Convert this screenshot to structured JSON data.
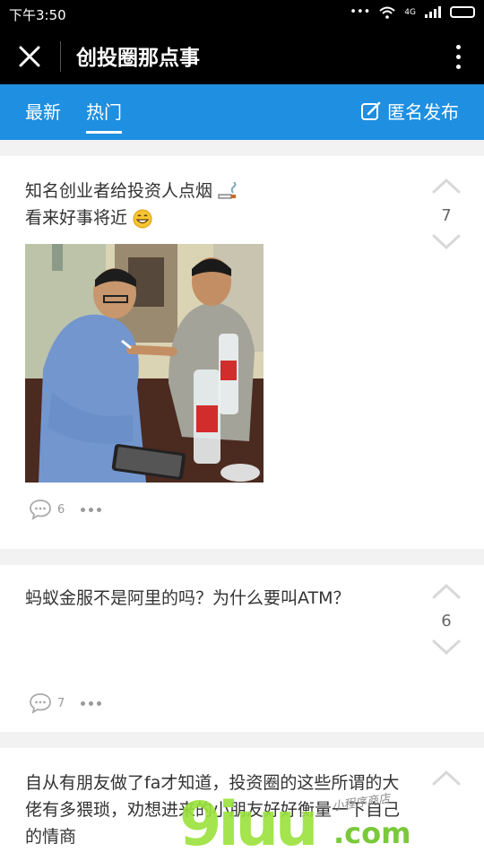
{
  "status_bar": {
    "time": "下午3:50",
    "network": "4G"
  },
  "header": {
    "title": "创投圈那点事"
  },
  "tabs": [
    {
      "label": "最新",
      "active": false
    },
    {
      "label": "热门",
      "active": true
    }
  ],
  "anonymous_post_label": "匿名发布",
  "colors": {
    "accent": "#1e8fe1",
    "header_bg": "#000000",
    "watermark_green": "#9be23b"
  },
  "posts": [
    {
      "text_line1": "知名创业者给投资人点烟",
      "text_line2": "看来好事将近",
      "votes": "7",
      "comments": "6",
      "has_image": true
    },
    {
      "text": "蚂蚁金服不是阿里的吗？为什么要叫ATM？",
      "votes": "6",
      "comments": "7",
      "has_image": false
    },
    {
      "text": "自从有朋友做了fa才知道，投资圈的这些所谓的大佬有多猥琐，劝想进来的小朋友好好衡量一下自己的情商",
      "votes": ""
    }
  ],
  "watermark": {
    "big": "9iuu",
    "domain": ".com",
    "handwritten": "小程序商店"
  }
}
